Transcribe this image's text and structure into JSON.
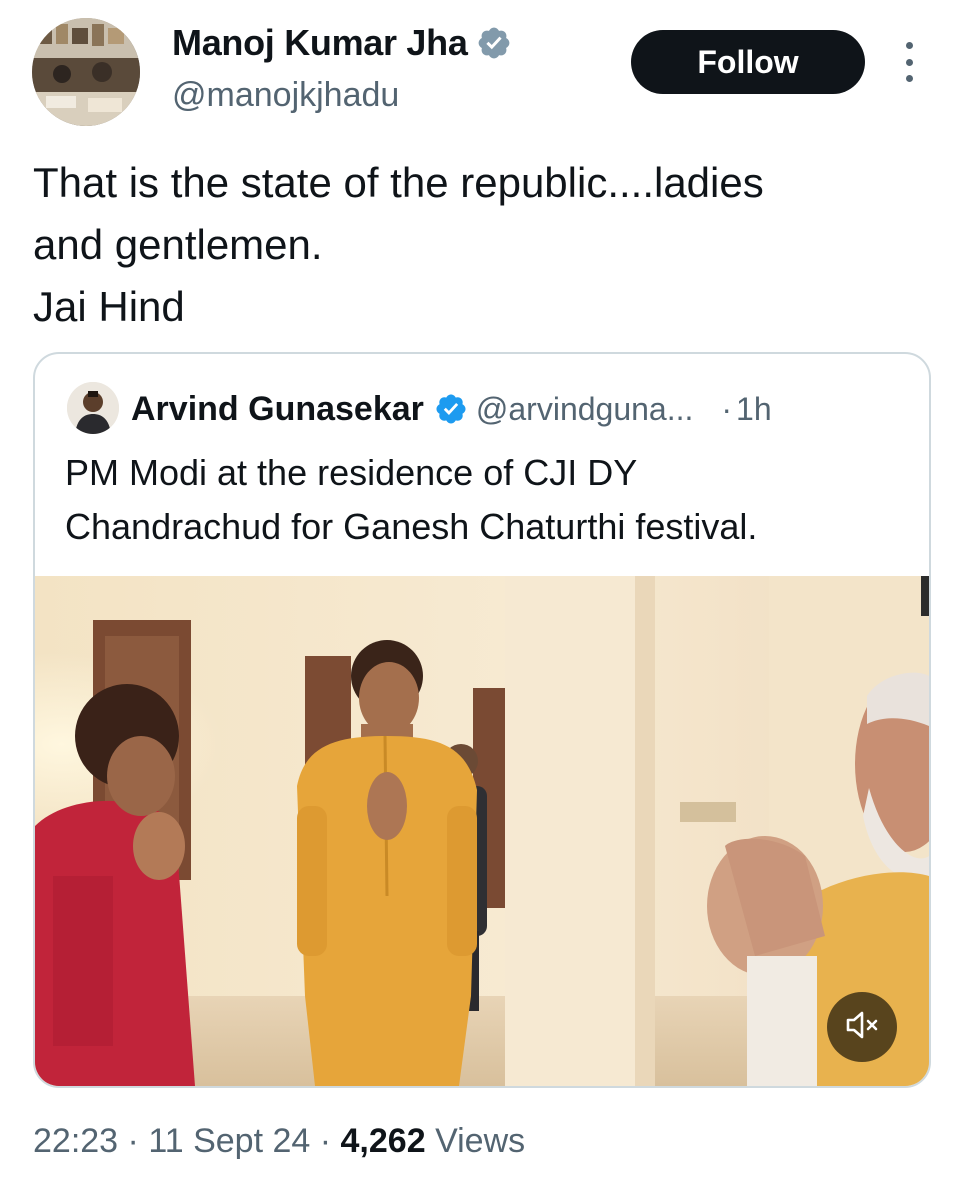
{
  "author": {
    "name": "Manoj Kumar Jha",
    "handle": "@manojkjhadu",
    "verified": true
  },
  "follow_label": "Follow",
  "tweet": {
    "lines": [
      "That is the state of the republic....ladies",
      "and gentlemen.",
      "Jai Hind"
    ]
  },
  "quote": {
    "name": "Arvind Gunasekar",
    "handle": "@arvindguna...",
    "separator": "·",
    "time": "1h",
    "lines": [
      "PM Modi at the residence of CJI DY",
      "Chandrachud for Ganesh Chaturthi festival."
    ],
    "media": {
      "type": "video",
      "muted": true,
      "mute_icon": "speaker-muted-icon"
    }
  },
  "footer": {
    "time": "22:23",
    "sep1": "·",
    "date": "11 Sept 24",
    "sep2": "·",
    "views_count": "4,262",
    "views_label": "Views"
  },
  "colors": {
    "text": "#0f1419",
    "secondary": "#536471",
    "verified_badge": "#829aab",
    "quote_verified_badge": "#1d9bf0",
    "border": "#cfd9de"
  }
}
